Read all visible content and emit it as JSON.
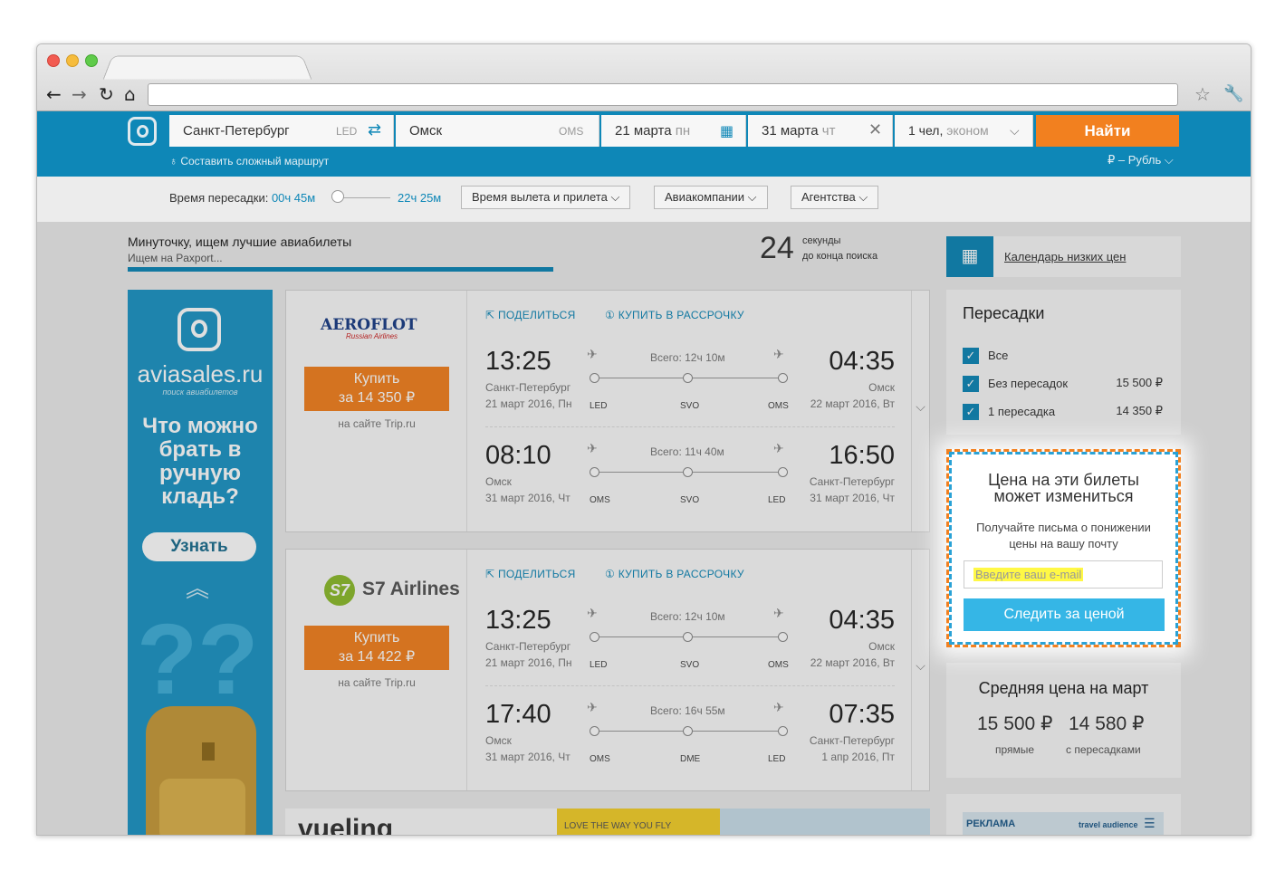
{
  "header": {
    "from_city": "Санкт-Петербург",
    "from_code": "LED",
    "to_city": "Омск",
    "to_code": "OMS",
    "depart_date": "21 марта",
    "depart_day": "пн",
    "return_date": "31 марта",
    "return_day": "чт",
    "passengers": "1 чел,",
    "class": "эконом",
    "search_button": "Найти",
    "complex_route": "Составить сложный маршрут",
    "currency": "₽ – Рубль"
  },
  "filters": {
    "transfer_label": "Время пересадки:",
    "transfer_min": "00ч 45м",
    "transfer_max": "22ч 25м",
    "times": "Время вылета и прилета",
    "airlines": "Авиакомпании",
    "agencies": "Агентства"
  },
  "progress": {
    "title": "Минуточку, ищем лучшие авиабилеты",
    "subtitle": "Ищем на Paxport...",
    "countdown": "24",
    "countdown_t1": "секунды",
    "countdown_t2": "до конца поиска"
  },
  "calendar_link": "Календарь низких цен",
  "banner": {
    "brand": "aviasales.ru",
    "tagline": "поиск авиабилетов",
    "headline": "Что можно брать в ручную кладь?",
    "button": "Узнать"
  },
  "results": [
    {
      "airline": "AEROFLOT",
      "airline_sub": "Russian Airlines",
      "buy_label": "Купить",
      "price": "за 14 350 ₽",
      "site": "на сайте Trip.ru",
      "share": "ПОДЕЛИТЬСЯ",
      "installment": "КУПИТЬ В РАССРОЧКУ",
      "legs": [
        {
          "dep": "13:25",
          "arr": "04:35",
          "total": "Всего: 12ч 10м",
          "from": "Санкт-Петербург",
          "from_date": "21 март 2016, Пн",
          "to": "Омск",
          "to_date": "22 март 2016, Вт",
          "a1": "LED",
          "a2": "SVO",
          "a3": "OMS"
        },
        {
          "dep": "08:10",
          "arr": "16:50",
          "total": "Всего: 11ч 40м",
          "from": "Омск",
          "from_date": "31 март 2016, Чт",
          "to": "Санкт-Петербург",
          "to_date": "31 март 2016, Чт",
          "a1": "OMS",
          "a2": "SVO",
          "a3": "LED"
        }
      ]
    },
    {
      "airline": "S7 Airlines",
      "airline_sub": "",
      "buy_label": "Купить",
      "price": "за 14 422 ₽",
      "site": "на сайте Trip.ru",
      "share": "ПОДЕЛИТЬСЯ",
      "installment": "КУПИТЬ В РАССРОЧКУ",
      "legs": [
        {
          "dep": "13:25",
          "arr": "04:35",
          "total": "Всего: 12ч 10м",
          "from": "Санкт-Петербург",
          "from_date": "21 март 2016, Пн",
          "to": "Омск",
          "to_date": "22 март 2016, Вт",
          "a1": "LED",
          "a2": "SVO",
          "a3": "OMS"
        },
        {
          "dep": "17:40",
          "arr": "07:35",
          "total": "Всего: 16ч 55м",
          "from": "Омск",
          "from_date": "31 март 2016, Чт",
          "to": "Санкт-Петербург",
          "to_date": "1 апр 2016, Пт",
          "a1": "OMS",
          "a2": "DME",
          "a3": "LED"
        }
      ]
    }
  ],
  "ad_strip": {
    "brand": "vueling",
    "slogan": "LOVE THE WAY YOU FLY"
  },
  "transfers": {
    "title": "Пересадки",
    "items": [
      {
        "label": "Все",
        "price": ""
      },
      {
        "label": "Без пересадок",
        "price": "15 500 ₽"
      },
      {
        "label": "1 пересадка",
        "price": "14 350 ₽"
      }
    ]
  },
  "subscribe": {
    "title1": "Цена на эти билеты",
    "title2": "может измениться",
    "text1": "Получайте письма о понижении",
    "text2": "цены на вашу почту",
    "placeholder": "Введите ваш e-mail",
    "button": "Следить за ценой"
  },
  "avg": {
    "title": "Средняя цена на март",
    "direct_price": "15 500 ₽",
    "direct_label": "прямые",
    "transfer_price": "14 580 ₽",
    "transfer_label": "с пересадками"
  },
  "ad_box": {
    "label": "РЕКЛАМА",
    "brand": "travel audience"
  },
  "colors": {
    "brand": "#0e87b7",
    "accent": "#f2801f",
    "button": "#35b6e6"
  }
}
